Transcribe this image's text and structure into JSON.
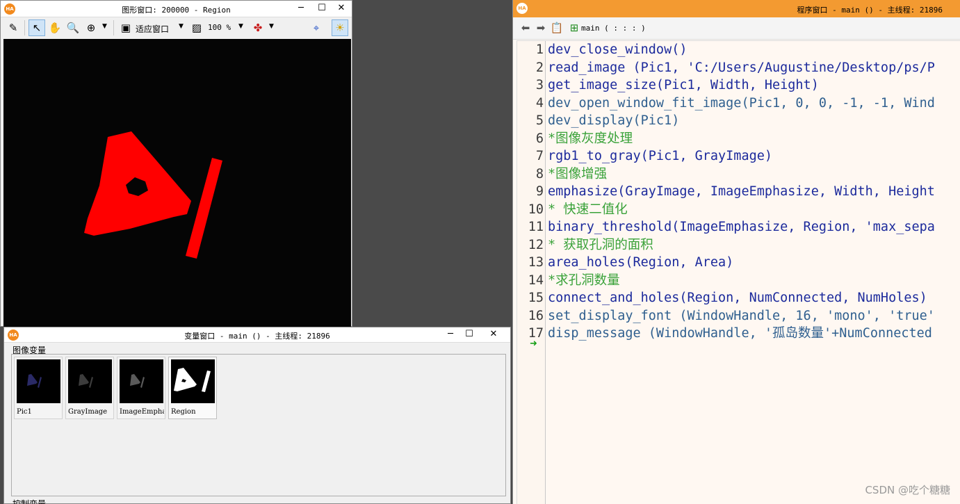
{
  "graphics_window": {
    "title": "图形窗口: 200000 - Region",
    "toolbar": {
      "fit_label": "适应窗口",
      "zoom_value": "100 %"
    }
  },
  "variables_window": {
    "title": "变量窗口 - main () - 主线程: 21896",
    "image_vars_label": "图像变量",
    "control_vars_label": "控制变量",
    "thumbnails": [
      {
        "label": "Pic1"
      },
      {
        "label": "GrayImage"
      },
      {
        "label": "ImageEmphasize"
      },
      {
        "label": "Region"
      }
    ]
  },
  "program_window": {
    "title": "程序窗口 - main () - 主线程: 21896",
    "procedure_label": "main ( : : : )",
    "lines": [
      {
        "num": "1",
        "kind": "op",
        "text": "dev_close_window()"
      },
      {
        "num": "2",
        "kind": "op",
        "text": "read_image (Pic1, 'C:/Users/Augustine/Desktop/ps/P"
      },
      {
        "num": "3",
        "kind": "op",
        "text": "get_image_size(Pic1, Width, Height)"
      },
      {
        "num": "4",
        "kind": "fn",
        "text": "dev_open_window_fit_image(Pic1, 0, 0, -1, -1, Wind"
      },
      {
        "num": "5",
        "kind": "fn",
        "text": "dev_display(Pic1)"
      },
      {
        "num": "6",
        "kind": "cm",
        "text": "*图像灰度处理"
      },
      {
        "num": "7",
        "kind": "op",
        "text": "rgb1_to_gray(Pic1, GrayImage)"
      },
      {
        "num": "8",
        "kind": "cm",
        "text": "*图像增强"
      },
      {
        "num": "9",
        "kind": "op",
        "text": "emphasize(GrayImage, ImageEmphasize, Width, Height"
      },
      {
        "num": "10",
        "kind": "cm",
        "text": "* 快速二值化"
      },
      {
        "num": "11",
        "kind": "op",
        "text": "binary_threshold(ImageEmphasize, Region, 'max_sepa"
      },
      {
        "num": "12",
        "kind": "cm",
        "text": "* 获取孔洞的面积"
      },
      {
        "num": "13",
        "kind": "op",
        "text": "area_holes(Region, Area)"
      },
      {
        "num": "14",
        "kind": "cm",
        "text": "*求孔洞数量"
      },
      {
        "num": "15",
        "kind": "op",
        "text": "connect_and_holes(Region, NumConnected, NumHoles)"
      },
      {
        "num": "16",
        "kind": "fn",
        "text": "set_display_font (WindowHandle, 16, 'mono', 'true'"
      },
      {
        "num": "17",
        "kind": "fn",
        "text": "disp_message (WindowHandle, '孤岛数量'+NumConnected"
      }
    ]
  },
  "watermark": "CSDN @吃个糖糖",
  "colors": {
    "region": "#ff0000",
    "program_title": "#f39a31",
    "comment": "#3aa23a",
    "operator": "#1c2a9c",
    "dev_op": "#2f5f8f"
  }
}
